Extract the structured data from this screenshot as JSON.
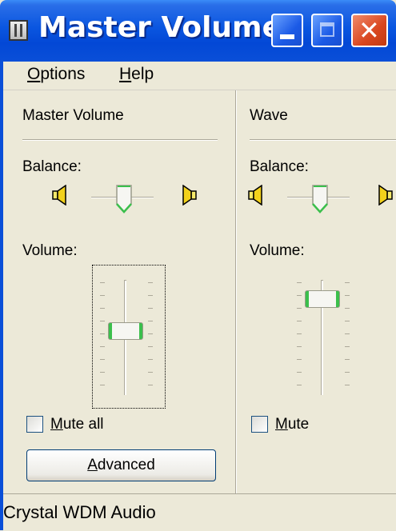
{
  "window": {
    "title": "Master Volume"
  },
  "menu": {
    "options": {
      "mnemonic": "O",
      "rest": "ptions"
    },
    "help": {
      "mnemonic": "H",
      "rest": "elp"
    }
  },
  "columns": [
    {
      "heading": "Master Volume",
      "balance_label": "Balance:",
      "volume_label": "Volume:",
      "balance_position": 0.5,
      "volume_level": 0.55,
      "mute": {
        "mnemonic": "M",
        "rest": "ute all",
        "checked": false
      },
      "advanced_button": {
        "mnemonic": "A",
        "rest": "dvanced"
      }
    },
    {
      "heading": "Wave",
      "balance_label": "Balance:",
      "volume_label": "Volume:",
      "balance_position": 0.5,
      "volume_level": 0.85,
      "mute": {
        "mnemonic": "M",
        "rest": "ute",
        "checked": false
      }
    }
  ],
  "status": {
    "text": "Crystal WDM Audio"
  },
  "colors": {
    "titlebar": "#0a56e0",
    "face": "#ece9d8",
    "accent": "#3bbf4c",
    "close": "#d9461f"
  },
  "icons": [
    "window-icon",
    "minimize-icon",
    "maximize-icon",
    "close-icon",
    "speaker-left-icon",
    "speaker-right-icon"
  ]
}
